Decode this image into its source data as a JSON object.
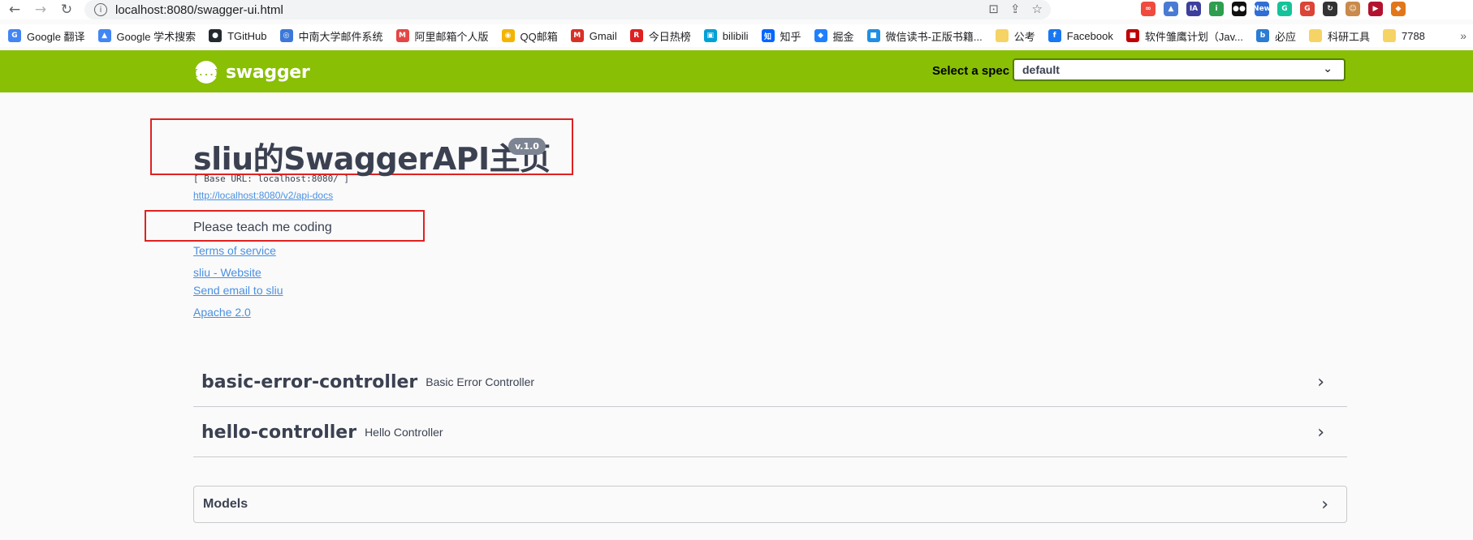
{
  "browser": {
    "url": "localhost:8080/swagger-ui.html",
    "bookmarks": [
      {
        "label": "Google 翻译",
        "icon": "google-translate-icon",
        "color": "#4285f4",
        "glyph": "G"
      },
      {
        "label": "Google 学术搜索",
        "icon": "google-scholar-icon",
        "color": "#4285f4",
        "glyph": "▲"
      },
      {
        "label": "TGitHub",
        "icon": "github-icon",
        "color": "#24292e",
        "glyph": "●"
      },
      {
        "label": "中南大学邮件系统",
        "icon": "mail-globe-icon",
        "color": "#3c78d8",
        "glyph": "◎"
      },
      {
        "label": "阿里邮箱个人版",
        "icon": "aliyun-mail-icon",
        "color": "#e64545",
        "glyph": "M"
      },
      {
        "label": "QQ邮箱",
        "icon": "qq-mail-icon",
        "color": "#f4b400",
        "glyph": "◉"
      },
      {
        "label": "Gmail",
        "icon": "gmail-icon",
        "color": "#d93025",
        "glyph": "M"
      },
      {
        "label": "今日热榜",
        "icon": "rebang-icon",
        "color": "#e02020",
        "glyph": "R"
      },
      {
        "label": "bilibili",
        "icon": "bilibili-icon",
        "color": "#00a1d6",
        "glyph": "▣"
      },
      {
        "label": "知乎",
        "icon": "zhihu-icon",
        "color": "#0066ff",
        "glyph": "知"
      },
      {
        "label": "掘金",
        "icon": "juejin-icon",
        "color": "#1e80ff",
        "glyph": "◆"
      },
      {
        "label": "微信读书-正版书籍...",
        "icon": "weread-icon",
        "color": "#1f8fe5",
        "glyph": "■"
      },
      {
        "label": "公考",
        "icon": "folder-icon",
        "color": "#f6d365",
        "glyph": ""
      },
      {
        "label": "Facebook",
        "icon": "facebook-icon",
        "color": "#1877f2",
        "glyph": "f"
      },
      {
        "label": "软件雏鹰计划（Jav...",
        "icon": "software-plan-icon",
        "color": "#c00000",
        "glyph": "■"
      },
      {
        "label": "必应",
        "icon": "bing-icon",
        "color": "#2b7cd3",
        "glyph": "b"
      },
      {
        "label": "科研工具",
        "icon": "folder-icon",
        "color": "#f6d365",
        "glyph": ""
      },
      {
        "label": "7788",
        "icon": "folder-icon",
        "color": "#f6d365",
        "glyph": ""
      }
    ],
    "extensions": [
      {
        "name": "ext-infinity-icon",
        "color": "#ef4b3f",
        "glyph": "∞"
      },
      {
        "name": "ext-scholar-icon",
        "color": "#4a7bd4",
        "glyph": "▲"
      },
      {
        "name": "ext-ia-icon",
        "color": "#3d3f9d",
        "glyph": "IA"
      },
      {
        "name": "ext-info-icon",
        "color": "#2e9e4f",
        "glyph": "i"
      },
      {
        "name": "ext-tampermonkey-icon",
        "color": "#111111",
        "glyph": "●●"
      },
      {
        "name": "ext-new-icon",
        "color": "#2f6fd6",
        "glyph": "New"
      },
      {
        "name": "ext-grammarly-icon",
        "color": "#15c39a",
        "glyph": "G"
      },
      {
        "name": "ext-google-icon",
        "color": "#db4437",
        "glyph": "G"
      },
      {
        "name": "ext-refresh-icon",
        "color": "#333333",
        "glyph": "↻"
      },
      {
        "name": "ext-avatar-icon",
        "color": "#c98a4b",
        "glyph": "☺"
      },
      {
        "name": "ext-flag-icon",
        "color": "#b3122e",
        "glyph": "▶"
      },
      {
        "name": "ext-metamask-icon",
        "color": "#e2761b",
        "glyph": "◆"
      }
    ]
  },
  "swagger": {
    "logo_text": "swagger",
    "logo_mark": "{...}",
    "spec_label": "Select a spec",
    "spec_value": "default",
    "accent_color": "#89bf04"
  },
  "info": {
    "title": "sliu的SwaggerAPI主页",
    "version": "v.1.0",
    "base_url": "[ Base URL: localhost:8080/ ]",
    "api_docs_link": "http://localhost:8080/v2/api-docs",
    "description": "Please teach me coding",
    "terms": "Terms of service",
    "website": "sliu - Website",
    "email": "Send email to sliu",
    "license": "Apache 2.0"
  },
  "controllers": [
    {
      "name": "basic-error-controller",
      "description": "Basic Error Controller"
    },
    {
      "name": "hello-controller",
      "description": "Hello Controller"
    }
  ],
  "models": {
    "title": "Models"
  }
}
